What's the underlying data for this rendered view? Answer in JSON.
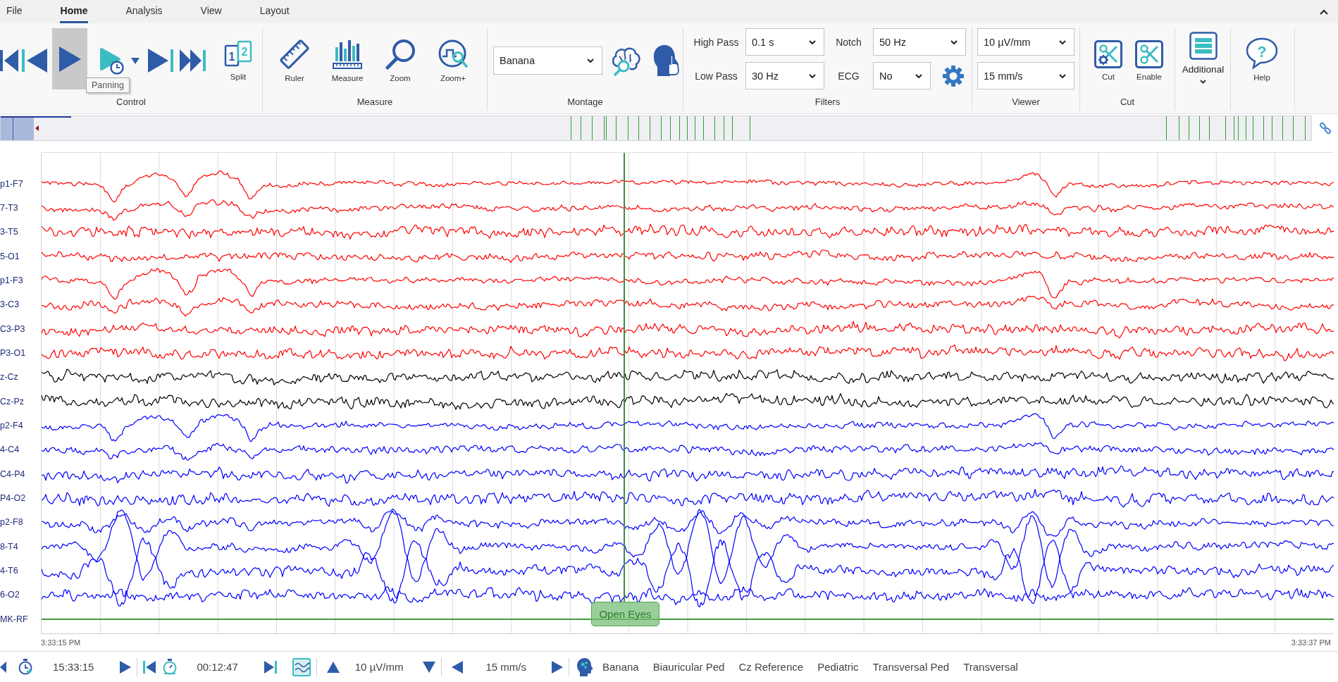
{
  "menu_tabs": [
    {
      "label": "File",
      "selected": false
    },
    {
      "label": "Home",
      "selected": true
    },
    {
      "label": "Analysis",
      "selected": false
    },
    {
      "label": "View",
      "selected": false
    },
    {
      "label": "Layout",
      "selected": false
    }
  ],
  "ribbon": {
    "control": {
      "label": "Control",
      "play": {
        "pressed": true
      },
      "tooltip": "Panning",
      "split": {
        "label": "Split",
        "glyphs": [
          "1",
          "2"
        ]
      }
    },
    "measure": {
      "label": "Measure",
      "tools": [
        {
          "kind": "ruler",
          "label": "Ruler"
        },
        {
          "kind": "measure",
          "label": "Measure"
        },
        {
          "kind": "zoom",
          "label": "Zoom"
        },
        {
          "kind": "zoom-plus",
          "label": "Zoom+"
        }
      ]
    },
    "montage": {
      "label": "Montage",
      "value": "Banana"
    },
    "filters": {
      "label": "Filters",
      "high_pass": {
        "label": "High Pass",
        "value": "0.1 s"
      },
      "notch": {
        "label": "Notch",
        "value": "50 Hz"
      },
      "low_pass": {
        "label": "Low Pass",
        "value": "30 Hz"
      },
      "ecg": {
        "label": "ECG",
        "value": "No"
      }
    },
    "viewer": {
      "label": "Viewer",
      "sensitivity": "10 µV/mm",
      "speed": "15 mm/s"
    },
    "cut": {
      "label": "Cut",
      "buttons": [
        {
          "kind": "cut",
          "label": "Cut"
        },
        {
          "kind": "enable",
          "label": "Enable"
        }
      ]
    },
    "additional": {
      "label": "Additional"
    },
    "help": {
      "label": "Help",
      "glyph": "?"
    }
  },
  "eeg": {
    "channels": [
      {
        "name": "p1-F7",
        "kind": "signal",
        "color": "#ff0000"
      },
      {
        "name": "7-T3",
        "kind": "signal",
        "color": "#ff0000"
      },
      {
        "name": "3-T5",
        "kind": "signal",
        "color": "#ff0000"
      },
      {
        "name": "5-O1",
        "kind": "signal",
        "color": "#ff0000"
      },
      {
        "name": "p1-F3",
        "kind": "signal",
        "color": "#ff0000"
      },
      {
        "name": "3-C3",
        "kind": "signal",
        "color": "#ff0000"
      },
      {
        "name": "C3-P3",
        "kind": "signal",
        "color": "#ff0000"
      },
      {
        "name": "P3-O1",
        "kind": "signal",
        "color": "#ff0000"
      },
      {
        "name": "z-Cz",
        "kind": "signal",
        "color": "#000000"
      },
      {
        "name": "Cz-Pz",
        "kind": "signal",
        "color": "#000000"
      },
      {
        "name": "p2-F4",
        "kind": "signal",
        "color": "#0000ff"
      },
      {
        "name": "4-C4",
        "kind": "signal",
        "color": "#0000ff"
      },
      {
        "name": "C4-P4",
        "kind": "signal",
        "color": "#0000ff"
      },
      {
        "name": "P4-O2",
        "kind": "signal",
        "color": "#0000ff"
      },
      {
        "name": "p2-F8",
        "kind": "signal",
        "color": "#0000ff"
      },
      {
        "name": "8-T4",
        "kind": "signal",
        "color": "#0000ff"
      },
      {
        "name": "4-T6",
        "kind": "signal",
        "color": "#0000ff"
      },
      {
        "name": "6-O2",
        "kind": "signal",
        "color": "#0000ff"
      },
      {
        "name": "MK-RF",
        "kind": "marker",
        "color": "#3c9a3c"
      }
    ],
    "event": {
      "label": "Open Eyes"
    },
    "start_time": "3:33:15 PM",
    "end_time": "3:33:37 PM"
  },
  "bottom_bar": {
    "clock_time": "15:33:15",
    "elapsed": "00:12:47",
    "sensitivity": "10 µV/mm",
    "speed": "15 mm/s",
    "montages": [
      {
        "label": "Banana"
      },
      {
        "label": "Biauricular Ped"
      },
      {
        "label": "Cz Reference"
      },
      {
        "label": "Pediatric"
      },
      {
        "label": "Transversal Ped"
      },
      {
        "label": "Transversal"
      }
    ]
  }
}
